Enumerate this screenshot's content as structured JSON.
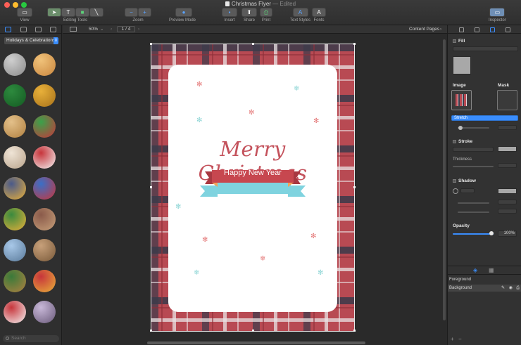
{
  "window": {
    "title": "Christmas Flyer",
    "edited": "— Edited"
  },
  "toolbar": {
    "view": "View",
    "editing_tools": "Editing Tools",
    "zoom": "Zoom",
    "preview_mode": "Preview Mode",
    "insert": "Insert",
    "share": "Share",
    "print": "Print",
    "text_styles": "Text Styles",
    "fonts": "Fonts",
    "inspector": "Inspector"
  },
  "left_panel": {
    "category": "Holidays & Celebrations",
    "search_placeholder": "Search"
  },
  "canvas_bar": {
    "zoom": "50%",
    "page": "1 / 4",
    "content_pages": "Content Pages"
  },
  "flyer": {
    "headline": "Merry Christmas",
    "ribbon": "Happy New Year",
    "colors": {
      "plaid": "#b94a52",
      "headline": "#c4525c",
      "ribbon": "#c7474f",
      "ribbon_blue": "#7fd3df"
    }
  },
  "inspector": {
    "fill": "Fill",
    "image": "Image",
    "mask": "Mask",
    "stretch": "Stretch",
    "stroke": "Stroke",
    "thickness": "Thickness",
    "shadow": "Shadow",
    "opacity": "Opacity",
    "opacity_value": "100%",
    "layers": {
      "foreground": "Foreground",
      "background": "Background"
    }
  },
  "icons": [
    "view-icon",
    "selection-tool-icon",
    "text-tool-icon",
    "shape-tool-icon",
    "line-tool-icon",
    "zoom-out-icon",
    "zoom-in-icon",
    "preview-icon",
    "insert-icon",
    "share-icon",
    "print-icon",
    "text-styles-icon",
    "fonts-icon",
    "inspector-icon"
  ]
}
